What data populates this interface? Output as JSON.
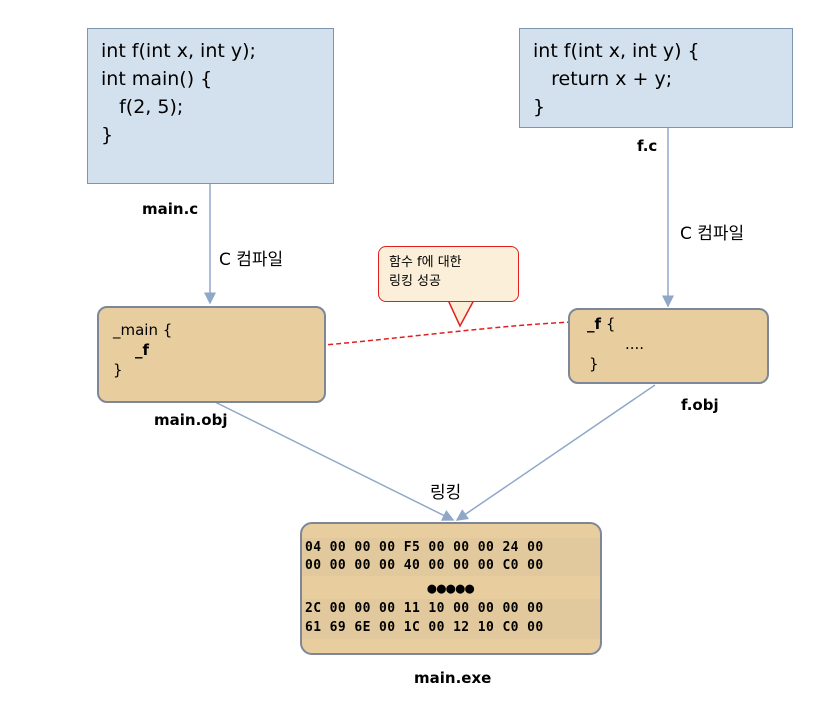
{
  "main_c": {
    "lines": [
      "int f(int x, int y);",
      "",
      "int main() {",
      "   f(2, 5);",
      "}"
    ],
    "label": "main.c"
  },
  "f_c": {
    "lines": [
      "int f(int x, int y) {",
      "   return x + y;",
      "}"
    ],
    "label": "f.c"
  },
  "compile_left": "C 컴파일",
  "compile_right": "C 컴파일",
  "main_obj": {
    "line1": "_main {",
    "symbol": "_f",
    "line3": "}",
    "label": "main.obj"
  },
  "f_obj": {
    "symbol": "_f",
    "brace": "{",
    "line2": "....",
    "line3": "}",
    "label": "f.obj"
  },
  "callout": {
    "line1": "함수 f에 대한",
    "line2": "링킹 성공"
  },
  "linking": "링킹",
  "main_exe": {
    "rows": [
      "04 00 00 00 F5 00 00 00 24 00",
      "00 00 00 00 40 00 00 00 C0 00",
      "●●●●●",
      "2C 00 00 00 11 10 00 00 00 00",
      "61 69 6E 00 1C 00 12 10 C0 00"
    ],
    "label": "main.exe"
  },
  "colors": {
    "source_fill": "#d3e1ee",
    "object_fill": "#e8ce9e",
    "link_arrow": "#e02020",
    "edge": "#8fa8c8"
  }
}
